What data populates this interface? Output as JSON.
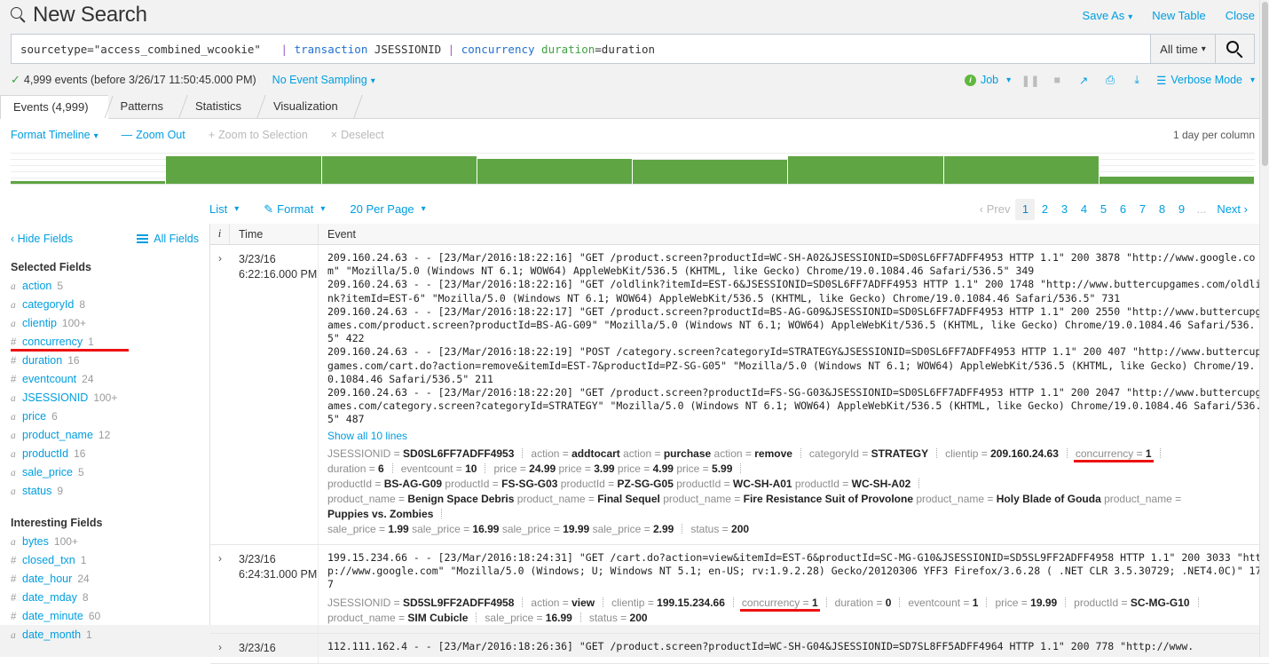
{
  "header": {
    "title": "New Search",
    "search_icon": "search-icon",
    "links": [
      {
        "label": "Save As",
        "caret": true
      },
      {
        "label": "New Table",
        "caret": false
      },
      {
        "label": "Close",
        "caret": false
      }
    ]
  },
  "search": {
    "query_tokens": [
      {
        "text": "sourcetype=\"access_combined_wcookie\"   ",
        "cls": "tok-base"
      },
      {
        "text": "| ",
        "cls": "tok-pipe"
      },
      {
        "text": "transaction ",
        "cls": "tok-cmd"
      },
      {
        "text": "JSESSIONID ",
        "cls": "tok-arg"
      },
      {
        "text": "| ",
        "cls": "tok-pipe"
      },
      {
        "text": "concurrency ",
        "cls": "tok-cmd"
      },
      {
        "text": "duration",
        "cls": "tok-green"
      },
      {
        "text": "=duration",
        "cls": "tok-arg"
      }
    ],
    "time_range": "All time",
    "go_icon": "search-icon"
  },
  "status": {
    "events_text": "4,999 events (before 3/26/17 11:50:45.000 PM)",
    "sampling": "No Event Sampling",
    "job": "Job",
    "mode": "Verbose Mode",
    "controls": [
      {
        "name": "pause-icon",
        "glyph": "❚❚"
      },
      {
        "name": "stop-icon",
        "glyph": "■"
      },
      {
        "name": "share-icon",
        "glyph": "↗"
      },
      {
        "name": "print-icon",
        "glyph": "⎙"
      },
      {
        "name": "export-icon",
        "glyph": "⤓"
      }
    ]
  },
  "tabs": [
    {
      "label": "Events (4,999)",
      "active": true
    },
    {
      "label": "Patterns",
      "active": false
    },
    {
      "label": "Statistics",
      "active": false
    },
    {
      "label": "Visualization",
      "active": false
    }
  ],
  "timeline": {
    "format_label": "Format Timeline",
    "zoom_out": "Zoom Out",
    "zoom_selection": "Zoom to Selection",
    "deselect": "Deselect",
    "per_column": "1 day per column",
    "bars": [
      10,
      88,
      88,
      80,
      76,
      88,
      88,
      22
    ]
  },
  "list_toolbar": {
    "view": "List",
    "format": "Format",
    "per_page": "20 Per Page",
    "prev": "Prev",
    "next": "Next",
    "pages": [
      "1",
      "2",
      "3",
      "4",
      "5",
      "6",
      "7",
      "8",
      "9"
    ],
    "ellipsis": "...",
    "current_page": "1"
  },
  "sidebar": {
    "hide_fields": "Hide Fields",
    "all_fields": "All Fields",
    "selected_title": "Selected Fields",
    "selected_fields": [
      {
        "type": "a",
        "name": "action",
        "count": "5",
        "highlight": false
      },
      {
        "type": "a",
        "name": "categoryId",
        "count": "8",
        "highlight": false
      },
      {
        "type": "a",
        "name": "clientip",
        "count": "100+",
        "highlight": false
      },
      {
        "type": "#",
        "name": "concurrency",
        "count": "1",
        "highlight": true
      },
      {
        "type": "#",
        "name": "duration",
        "count": "16",
        "highlight": false
      },
      {
        "type": "#",
        "name": "eventcount",
        "count": "24",
        "highlight": false
      },
      {
        "type": "a",
        "name": "JSESSIONID",
        "count": "100+",
        "highlight": false
      },
      {
        "type": "a",
        "name": "price",
        "count": "6",
        "highlight": false
      },
      {
        "type": "a",
        "name": "product_name",
        "count": "12",
        "highlight": false
      },
      {
        "type": "a",
        "name": "productId",
        "count": "16",
        "highlight": false
      },
      {
        "type": "a",
        "name": "sale_price",
        "count": "5",
        "highlight": false
      },
      {
        "type": "a",
        "name": "status",
        "count": "9",
        "highlight": false
      }
    ],
    "interesting_title": "Interesting Fields",
    "interesting_fields": [
      {
        "type": "a",
        "name": "bytes",
        "count": "100+",
        "highlight": false
      },
      {
        "type": "#",
        "name": "closed_txn",
        "count": "1",
        "highlight": false
      },
      {
        "type": "#",
        "name": "date_hour",
        "count": "24",
        "highlight": false
      },
      {
        "type": "#",
        "name": "date_mday",
        "count": "8",
        "highlight": false
      },
      {
        "type": "#",
        "name": "date_minute",
        "count": "60",
        "highlight": false
      },
      {
        "type": "a",
        "name": "date_month",
        "count": "1",
        "highlight": false
      }
    ]
  },
  "events_table": {
    "columns": {
      "i": "i",
      "time": "Time",
      "event": "Event"
    },
    "rows": [
      {
        "date": "3/23/16",
        "time": "6:22:16.000 PM",
        "raw": "209.160.24.63 - - [23/Mar/2016:18:22:16] \"GET /product.screen?productId=WC-SH-A02&JSESSIONID=SD0SL6FF7ADFF4953 HTTP 1.1\" 200 3878 \"http://www.google.com\" \"Mozilla/5.0 (Windows NT 6.1; WOW64) AppleWebKit/536.5 (KHTML, like Gecko) Chrome/19.0.1084.46 Safari/536.5\" 349\n209.160.24.63 - - [23/Mar/2016:18:22:16] \"GET /oldlink?itemId=EST-6&JSESSIONID=SD0SL6FF7ADFF4953 HTTP 1.1\" 200 1748 \"http://www.buttercupgames.com/oldlink?itemId=EST-6\" \"Mozilla/5.0 (Windows NT 6.1; WOW64) AppleWebKit/536.5 (KHTML, like Gecko) Chrome/19.0.1084.46 Safari/536.5\" 731\n209.160.24.63 - - [23/Mar/2016:18:22:17] \"GET /product.screen?productId=BS-AG-G09&JSESSIONID=SD0SL6FF7ADFF4953 HTTP 1.1\" 200 2550 \"http://www.buttercupgames.com/product.screen?productId=BS-AG-G09\" \"Mozilla/5.0 (Windows NT 6.1; WOW64) AppleWebKit/536.5 (KHTML, like Gecko) Chrome/19.0.1084.46 Safari/536.5\" 422\n209.160.24.63 - - [23/Mar/2016:18:22:19] \"POST /category.screen?categoryId=STRATEGY&JSESSIONID=SD0SL6FF7ADFF4953 HTTP 1.1\" 200 407 \"http://www.buttercupgames.com/cart.do?action=remove&itemId=EST-7&productId=PZ-SG-G05\" \"Mozilla/5.0 (Windows NT 6.1; WOW64) AppleWebKit/536.5 (KHTML, like Gecko) Chrome/19.0.1084.46 Safari/536.5\" 211\n209.160.24.63 - - [23/Mar/2016:18:22:20] \"GET /product.screen?productId=FS-SG-G03&JSESSIONID=SD0SL6FF7ADFF4953 HTTP 1.1\" 200 2047 \"http://www.buttercupgames.com/category.screen?categoryId=STRATEGY\" \"Mozilla/5.0 (Windows NT 6.1; WOW64) AppleWebKit/536.5 (KHTML, like Gecko) Chrome/19.0.1084.46 Safari/536.5\" 487",
        "show_all": "Show all 10 lines",
        "kv_lines": [
          [
            {
              "k": "JSESSIONID = ",
              "v": "SD0SL6FF7ADFF4953",
              "sep": true,
              "hl": false
            },
            {
              "k": "action = ",
              "v": "addtocart",
              "sep": false,
              "hl": false
            },
            {
              "k": " action = ",
              "v": "purchase",
              "sep": false,
              "hl": false
            },
            {
              "k": " action = ",
              "v": "remove",
              "sep": true,
              "hl": false
            },
            {
              "k": "categoryId = ",
              "v": "STRATEGY",
              "sep": true,
              "hl": false
            },
            {
              "k": "clientip = ",
              "v": "209.160.24.63",
              "sep": true,
              "hl": false
            },
            {
              "k": "concurrency = ",
              "v": "1",
              "sep": true,
              "hl": true
            }
          ],
          [
            {
              "k": "duration = ",
              "v": "6",
              "sep": true,
              "hl": false
            },
            {
              "k": "eventcount = ",
              "v": "10",
              "sep": true,
              "hl": false
            },
            {
              "k": "price = ",
              "v": "24.99",
              "sep": false,
              "hl": false
            },
            {
              "k": " price = ",
              "v": "3.99",
              "sep": false,
              "hl": false
            },
            {
              "k": " price = ",
              "v": "4.99",
              "sep": false,
              "hl": false
            },
            {
              "k": " price = ",
              "v": "5.99",
              "sep": true,
              "hl": false
            }
          ],
          [
            {
              "k": "productId = ",
              "v": "BS-AG-G09",
              "sep": false,
              "hl": false
            },
            {
              "k": " productId = ",
              "v": "FS-SG-G03",
              "sep": false,
              "hl": false
            },
            {
              "k": " productId = ",
              "v": "PZ-SG-G05",
              "sep": false,
              "hl": false
            },
            {
              "k": " productId = ",
              "v": "WC-SH-A01",
              "sep": false,
              "hl": false
            },
            {
              "k": " productId = ",
              "v": "WC-SH-A02",
              "sep": true,
              "hl": false
            }
          ],
          [
            {
              "k": "product_name = ",
              "v": "Benign Space Debris",
              "sep": false,
              "hl": false
            },
            {
              "k": " product_name = ",
              "v": "Final Sequel",
              "sep": false,
              "hl": false
            },
            {
              "k": " product_name = ",
              "v": "Fire Resistance Suit of Provolone",
              "sep": false,
              "hl": false
            },
            {
              "k": " product_name = ",
              "v": "Holy Blade of Gouda",
              "sep": false,
              "hl": false
            },
            {
              "k": " product_name = ",
              "v": "",
              "sep": false,
              "hl": false
            }
          ],
          [
            {
              "k": "",
              "v": "Puppies vs. Zombies",
              "sep": true,
              "hl": false
            }
          ],
          [
            {
              "k": "sale_price = ",
              "v": "1.99",
              "sep": false,
              "hl": false
            },
            {
              "k": " sale_price = ",
              "v": "16.99",
              "sep": false,
              "hl": false
            },
            {
              "k": " sale_price = ",
              "v": "19.99",
              "sep": false,
              "hl": false
            },
            {
              "k": " sale_price = ",
              "v": "2.99",
              "sep": true,
              "hl": false
            },
            {
              "k": "status = ",
              "v": "200",
              "sep": false,
              "hl": false
            }
          ]
        ]
      },
      {
        "date": "3/23/16",
        "time": "6:24:31.000 PM",
        "raw": "199.15.234.66 - - [23/Mar/2016:18:24:31] \"GET /cart.do?action=view&itemId=EST-6&productId=SC-MG-G10&JSESSIONID=SD5SL9FF2ADFF4958 HTTP 1.1\" 200 3033 \"http://www.google.com\" \"Mozilla/5.0 (Windows; U; Windows NT 5.1; en-US; rv:1.9.2.28) Gecko/20120306 YFF3 Firefox/3.6.28 ( .NET CLR 3.5.30729; .NET4.0C)\" 177",
        "show_all": "",
        "kv_lines": [
          [
            {
              "k": "JSESSIONID = ",
              "v": "SD5SL9FF2ADFF4958",
              "sep": true,
              "hl": false
            },
            {
              "k": "action = ",
              "v": "view",
              "sep": true,
              "hl": false
            },
            {
              "k": "clientip = ",
              "v": "199.15.234.66",
              "sep": true,
              "hl": false
            },
            {
              "k": "concurrency = ",
              "v": "1",
              "sep": true,
              "hl": true
            },
            {
              "k": "duration = ",
              "v": "0",
              "sep": true,
              "hl": false
            },
            {
              "k": "eventcount = ",
              "v": "1",
              "sep": true,
              "hl": false
            },
            {
              "k": "price = ",
              "v": "19.99",
              "sep": true,
              "hl": false
            },
            {
              "k": "productId = ",
              "v": "SC-MG-G10",
              "sep": true,
              "hl": false
            }
          ],
          [
            {
              "k": "product_name = ",
              "v": "SIM Cubicle",
              "sep": true,
              "hl": false
            },
            {
              "k": "sale_price = ",
              "v": "16.99",
              "sep": true,
              "hl": false
            },
            {
              "k": "status = ",
              "v": "200",
              "sep": false,
              "hl": false
            }
          ]
        ]
      },
      {
        "date": "3/23/16",
        "time": "",
        "raw": "112.111.162.4 - - [23/Mar/2016:18:26:36] \"GET /product.screen?productId=WC-SH-G04&JSESSIONID=SD7SL8FF5ADFF4964 HTTP 1.1\" 200 778 \"http://www.",
        "show_all": "",
        "kv_lines": []
      }
    ]
  },
  "colors": {
    "accent_blue": "#009ee0",
    "green_bar": "#5fa544",
    "highlight_red": "#ee1111"
  }
}
